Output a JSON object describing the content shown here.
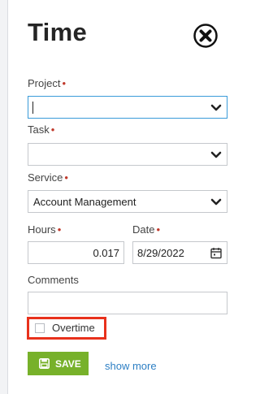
{
  "panel": {
    "title": "Time",
    "close_icon": "close-circle-x-icon"
  },
  "form": {
    "project": {
      "label": "Project",
      "required": "•",
      "value": ""
    },
    "task": {
      "label": "Task",
      "required": "•",
      "value": ""
    },
    "service": {
      "label": "Service",
      "required": "•",
      "value": "Account Management"
    },
    "hours": {
      "label": "Hours",
      "required": "•",
      "value": "0.017"
    },
    "date": {
      "label": "Date",
      "required": "•",
      "value": "8/29/2022"
    },
    "comments": {
      "label": "Comments",
      "value": ""
    },
    "overtime": {
      "label": "Overtime",
      "checked": false
    }
  },
  "actions": {
    "save_label": "SAVE",
    "show_more_label": "show more"
  },
  "colors": {
    "required": "#c0392b",
    "save_bg": "#77b12a",
    "link": "#2d7fc4",
    "highlight": "#e8311c",
    "focus_border": "#3a9bd9"
  }
}
